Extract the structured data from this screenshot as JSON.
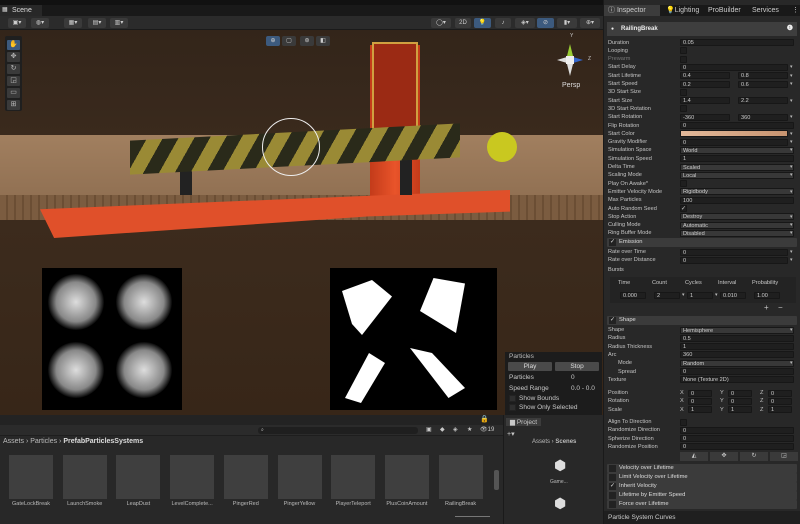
{
  "scene": {
    "tab": "Scene",
    "toolbar_2d": "2D",
    "persp": "Persp",
    "gizmo_axes": {
      "y": "Y",
      "z": "Z"
    }
  },
  "particles_overlay": {
    "title": "Particles",
    "play": "Play",
    "stop": "Stop",
    "particles_label": "Particles",
    "particles_value": "0",
    "speed_label": "Speed Range",
    "speed_value": "0.0 - 0.0",
    "show_bounds": "Show Bounds",
    "show_only_selected": "Show Only Selected"
  },
  "assets": {
    "breadcrumb": [
      "Assets",
      "Particles",
      "PrefabParticlesSystems"
    ],
    "visible_count": "19",
    "items": [
      "GateLockBreak",
      "LaunchSmoke",
      "LeapDust",
      "LevelComplete...",
      "PingerRed",
      "PingerYellow",
      "PlayerTeleport",
      "PlusCoinAmount",
      "RailingBreak"
    ]
  },
  "project": {
    "tab": "Project",
    "breadcrumb": [
      "Assets",
      "Scenes"
    ],
    "items": [
      "Game..."
    ]
  },
  "inspector": {
    "tabs": [
      "Inspector",
      "Lighting",
      "ProBuilder",
      "Services"
    ],
    "component": "RailingBreak",
    "rows": [
      {
        "label": "Duration",
        "type": "field",
        "value": "0.05"
      },
      {
        "label": "Looping",
        "type": "check"
      },
      {
        "label": "Prewarm",
        "type": "check",
        "dim": true
      },
      {
        "label": "Start Delay",
        "type": "field",
        "value": "0",
        "arrow": true
      },
      {
        "label": "Start Lifetime",
        "type": "split",
        "value": "0.4",
        "value2": "0.8",
        "arrow": true
      },
      {
        "label": "Start Speed",
        "type": "split",
        "value": "0.2",
        "value2": "0.6",
        "arrow": true
      },
      {
        "label": "3D Start Size",
        "type": "check"
      },
      {
        "label": "Start Size",
        "type": "split",
        "value": "1.4",
        "value2": "2.2",
        "arrow": true
      },
      {
        "label": "3D Start Rotation",
        "type": "check"
      },
      {
        "label": "Start Rotation",
        "type": "split",
        "value": "-360",
        "value2": "360",
        "arrow": true
      },
      {
        "label": "Flip Rotation",
        "type": "field",
        "value": "0"
      },
      {
        "label": "Start Color",
        "type": "color",
        "arrow": true
      },
      {
        "label": "Gravity Modifier",
        "type": "field",
        "value": "0",
        "arrow": true
      },
      {
        "label": "Simulation Space",
        "type": "dropdown",
        "value": "World"
      },
      {
        "label": "Simulation Speed",
        "type": "field",
        "value": "1"
      },
      {
        "label": "Delta Time",
        "type": "dropdown",
        "value": "Scaled"
      },
      {
        "label": "Scaling Mode",
        "type": "dropdown",
        "value": "Local"
      },
      {
        "label": "Play On Awake*",
        "type": "check"
      },
      {
        "label": "Emitter Velocity Mode",
        "type": "dropdown",
        "value": "Rigidbody"
      },
      {
        "label": "Max Particles",
        "type": "field",
        "value": "100"
      },
      {
        "label": "Auto Random Seed",
        "type": "checked"
      },
      {
        "label": "Stop Action",
        "type": "dropdown",
        "value": "Destroy"
      },
      {
        "label": "Culling Mode",
        "type": "dropdown",
        "value": "Automatic"
      },
      {
        "label": "Ring Buffer Mode",
        "type": "dropdown",
        "value": "Disabled"
      }
    ],
    "emission": {
      "header": "Emission",
      "rows": [
        {
          "label": "Rate over Time",
          "value": "0"
        },
        {
          "label": "Rate over Distance",
          "value": "0"
        }
      ],
      "bursts_label": "Bursts",
      "burst_columns": [
        "Time",
        "Count",
        "Cycles",
        "Interval",
        "Probability"
      ],
      "burst_row": [
        "0.000",
        "2",
        "1",
        "0.010",
        "1.00"
      ],
      "add": "+",
      "remove": "−"
    },
    "shape": {
      "header": "Shape",
      "rows": [
        {
          "label": "Shape",
          "type": "dropdown",
          "value": "Hemisphere"
        },
        {
          "label": "Radius",
          "type": "field",
          "value": "0.5"
        },
        {
          "label": "Radius Thickness",
          "type": "field",
          "value": "1"
        },
        {
          "label": "Arc",
          "type": "field",
          "value": "360"
        },
        {
          "label": "Mode",
          "type": "dropdown",
          "value": "Random",
          "indent": true
        },
        {
          "label": "Spread",
          "type": "field",
          "value": "0",
          "indent": true
        },
        {
          "label": "Texture",
          "type": "field",
          "value": "None (Texture 2D)"
        }
      ],
      "transforms": [
        {
          "label": "Position",
          "x": "0",
          "y": "0",
          "z": "0"
        },
        {
          "label": "Rotation",
          "x": "0",
          "y": "0",
          "z": "0"
        },
        {
          "label": "Scale",
          "x": "1",
          "y": "1",
          "z": "1"
        }
      ],
      "rows2": [
        {
          "label": "Align To Direction",
          "type": "check"
        },
        {
          "label": "Randomize Direction",
          "type": "field",
          "value": "0"
        },
        {
          "label": "Spherize Direction",
          "type": "field",
          "value": "0"
        },
        {
          "label": "Randomize Position",
          "type": "field",
          "value": "0"
        }
      ]
    },
    "modules": [
      {
        "label": "Velocity over Lifetime",
        "enabled": false
      },
      {
        "label": "Limit Velocity over Lifetime",
        "enabled": false
      },
      {
        "label": "Inherit Velocity",
        "enabled": true
      },
      {
        "label": "Lifetime by Emitter Speed",
        "enabled": false
      },
      {
        "label": "Force over Lifetime",
        "enabled": false
      }
    ],
    "curves_title": "Particle System Curves"
  }
}
